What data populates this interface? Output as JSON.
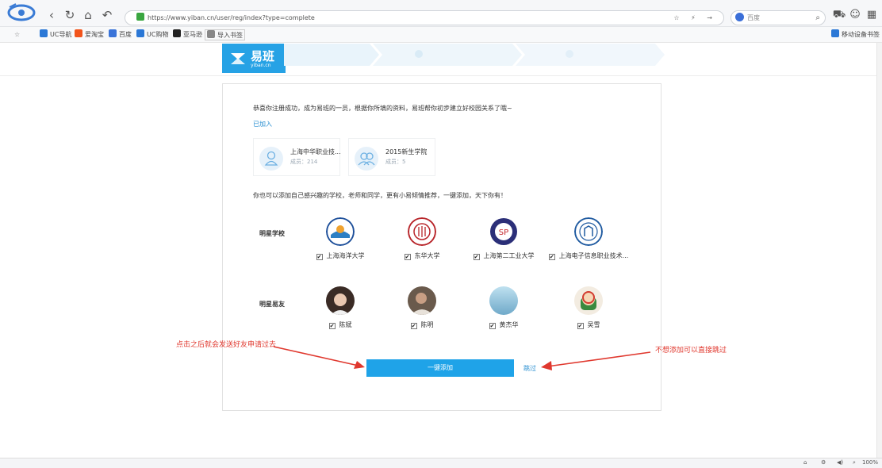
{
  "browser": {
    "url": "https://www.yiban.cn/user/reg/index?type=complete",
    "search_engine": "百度",
    "zoom": "100%",
    "bookmarks": [
      "UC导航",
      "爱淘宝",
      "百度",
      "UC购物",
      "亚马逊",
      "导入书签"
    ],
    "mobile_bookmarks": "移动设备书签"
  },
  "logo": {
    "text": "易班",
    "sub": "yiban.cn"
  },
  "card": {
    "intro": "恭喜你注册成功，成为易班的一员，根据你所填的资料，易班帮你初步建立好校园关系了哦~",
    "joined_label": "已加入",
    "groups": [
      {
        "name": "上海中华职业技...",
        "members": "成员：214"
      },
      {
        "name": "2015新生学院",
        "members": "成员：5"
      }
    ],
    "suggest_text": "你也可以添加自己感兴趣的学校，老师和同学，更有小易倾情推荐，一键添加，天下你有！",
    "schools_title": "明星学校",
    "schools": [
      "上海海洋大学",
      "东华大学",
      "上海第二工业大学",
      "上海电子信息职业技术..."
    ],
    "friends_title": "明星易友",
    "friends": [
      "陈斌",
      "陈明",
      "黄杰华",
      "吴雪"
    ],
    "add_button": "一键添加",
    "skip_link": "跳过"
  },
  "annotations": {
    "left": "点击之后就会发送好友申请过去",
    "right": "不想添加可以直接跳过"
  },
  "colors": {
    "brand": "#26a2e5",
    "button": "#1fa3e8",
    "link": "#2a8fd1",
    "annotation": "#e0382e"
  }
}
